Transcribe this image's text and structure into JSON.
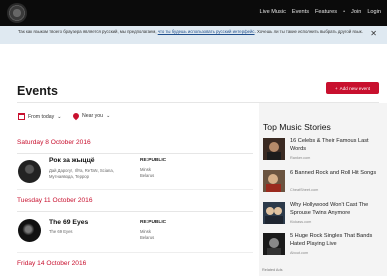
{
  "nav": {
    "items": [
      "Live Music",
      "Events",
      "Features"
    ],
    "separator": "•",
    "join": "Join",
    "login": "Login"
  },
  "notice": {
    "text_before": "Так как языком твоего браузера является русский, мы предполагаем, ",
    "link": "что ты будешь использовать русский интерфейс",
    "text_after": ". Хочешь ли ты такие исполнить выбрать другой язык.",
    "close": "✕"
  },
  "events": {
    "title": "Events",
    "add_button": "Add new event",
    "add_icon": "+",
    "filters": {
      "date": "From today",
      "location": "Near you",
      "chevron": "⌄"
    },
    "days": [
      {
        "label": "Saturday 8 October 2016",
        "event": {
          "title": "Рок за жыццё",
          "artists": "Дай Дарогу!, IllYa, ReTaN, Sciana, Мутнаявода, Террор",
          "venue": "RE:PUBLIC",
          "city": "Minsk",
          "country": "Belarus"
        }
      },
      {
        "label": "Tuesday 11 October 2016",
        "event": {
          "title": "The 69 Eyes",
          "artists": "The 69 Eyes",
          "venue": "RE:PUBLIC",
          "city": "Minsk",
          "country": "Belarus"
        }
      },
      {
        "label": "Friday 14 October 2016"
      }
    ]
  },
  "sidebar": {
    "title": "Top Music Stories",
    "stories": [
      {
        "title": "16 Celebs & Their Famous Last Words",
        "source": "Ranker.com"
      },
      {
        "title": "6 Banned Rock and Roll Hit Songs",
        "source": "CheatSheet.com"
      },
      {
        "title": "Why Hollywood Won't Cast The Sprouse Twins Anymore",
        "source": "Kickass.com"
      },
      {
        "title": "5 Huge Rock Singles That Bands Hated Playing Live",
        "source": "About.com"
      }
    ],
    "related": "Related Ads"
  },
  "colors": {
    "accent": "#c8102e",
    "topbar": "#0b0b0b",
    "notice_bg": "#dfe9f1",
    "sidebar_bg": "#f4f4f4"
  }
}
